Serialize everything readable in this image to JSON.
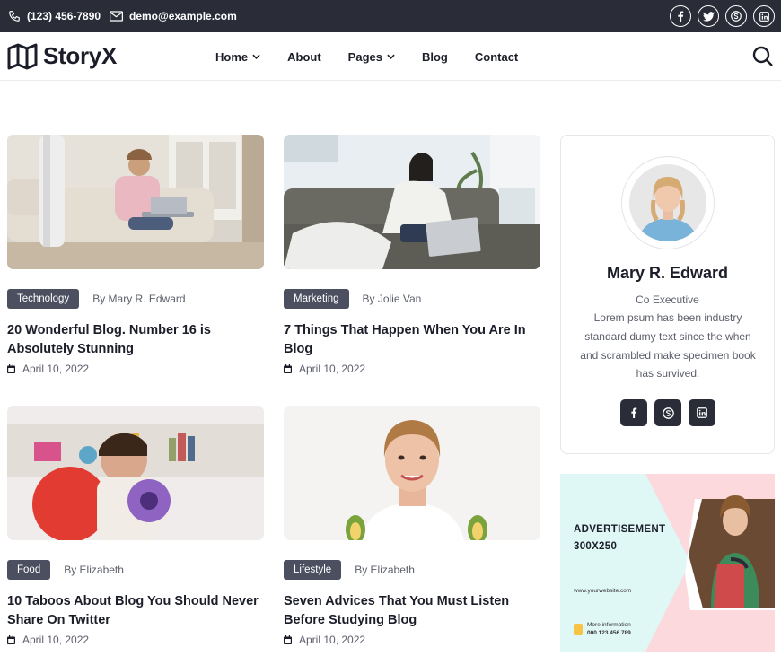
{
  "topbar": {
    "phone": "(123) 456-7890",
    "email": "demo@example.com",
    "social": [
      "facebook-icon",
      "twitter-icon",
      "skype-icon",
      "linkedin-icon"
    ]
  },
  "brand": {
    "name": "StoryX"
  },
  "nav": {
    "items": [
      {
        "label": "Home",
        "dropdown": true
      },
      {
        "label": "About",
        "dropdown": false
      },
      {
        "label": "Pages",
        "dropdown": true
      },
      {
        "label": "Blog",
        "dropdown": false
      },
      {
        "label": "Contact",
        "dropdown": false
      }
    ]
  },
  "posts": [
    {
      "category": "Technology",
      "author": "By Mary R. Edward",
      "title": "20 Wonderful Blog. Number 16 is Absolutely Stunning",
      "date": "April 10, 2022"
    },
    {
      "category": "Marketing",
      "author": "By Jolie Van",
      "title": "7 Things That Happen When You Are In Blog",
      "date": "April 10, 2022"
    },
    {
      "category": "Food",
      "author": "By Elizabeth",
      "title": "10 Taboos About Blog You Should Never Share On Twitter",
      "date": "April 10, 2022"
    },
    {
      "category": "Lifestyle",
      "author": "By Elizabeth",
      "title": "Seven Advices That You Must Listen Before Studying Blog",
      "date": "April 10, 2022"
    }
  ],
  "author_card": {
    "name": "Mary R. Edward",
    "role": "Co Executive",
    "bio": "Lorem psum has been industry standard dumy text since the when and scrambled make specimen book has survived.",
    "social": [
      "facebook-icon",
      "skype-icon",
      "linkedin-icon"
    ]
  },
  "ad": {
    "title_line1": "ADVERTISEMENT",
    "title_line2": "300X250",
    "url": "www.yourwebsite.com",
    "info_line1": "More information",
    "info_line2": "000 123 456 789"
  },
  "colors": {
    "topbar_bg": "#2a2c38",
    "tag_bg": "#4c4f5f",
    "text_dark": "#1b1d29",
    "text_muted": "#5c5f6b",
    "ad_mint": "#dff7f5",
    "ad_pink": "#fcd9dc"
  }
}
